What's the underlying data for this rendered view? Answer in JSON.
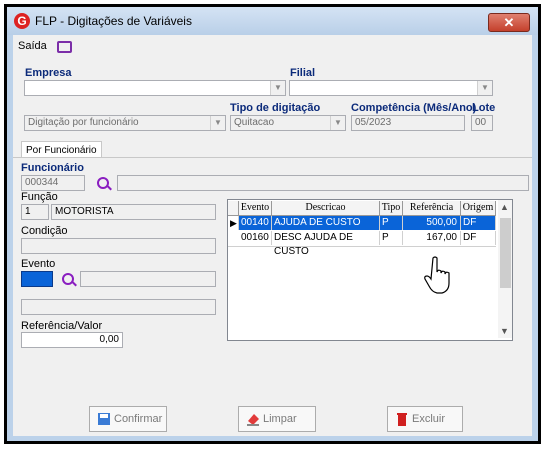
{
  "window": {
    "title": "FLP - Digitações de Variáveis",
    "close_glyph": "✕"
  },
  "menu": {
    "saida": "Saída"
  },
  "empresa": {
    "label": "Empresa",
    "value": ""
  },
  "filial": {
    "label": "Filial",
    "value": ""
  },
  "digitacao": {
    "value": "Digitação por funcionário"
  },
  "tipo_digitacao": {
    "label": "Tipo de digitação",
    "value": "Quitacao"
  },
  "competencia": {
    "label": "Competência (Mês/Ano)",
    "value": "05/2023"
  },
  "lote": {
    "label": "Lote",
    "value": "00"
  },
  "tab": {
    "label": "Por Funcionário"
  },
  "funcionario": {
    "label": "Funcionário",
    "code": "000344",
    "name": ""
  },
  "funcao": {
    "label": "Função",
    "code": "1",
    "name": "MOTORISTA"
  },
  "condicao": {
    "label": "Condição",
    "value": ""
  },
  "evento": {
    "label": "Evento",
    "code": "",
    "name": "",
    "extra": ""
  },
  "referencia_valor": {
    "label": "Referência/Valor",
    "value": "0,00"
  },
  "grid": {
    "columns": [
      "Evento",
      "Descricao",
      "Tipo",
      "Referência",
      "Origem"
    ],
    "rows": [
      {
        "evento": "00140",
        "descricao": "AJUDA DE CUSTO",
        "tipo": "P",
        "referencia": "500,00",
        "origem": "DF",
        "selected": true
      },
      {
        "evento": "00160",
        "descricao": "DESC AJUDA DE CUSTO",
        "tipo": "P",
        "referencia": "167,00",
        "origem": "DF",
        "selected": false
      }
    ]
  },
  "buttons": {
    "confirmar": "Confirmar",
    "limpar": "Limpar",
    "excluir": "Excluir"
  },
  "colors": {
    "accent": "#0a64d8",
    "label_blue": "#0b2a7a",
    "icon_purple": "#8a1ec0"
  }
}
